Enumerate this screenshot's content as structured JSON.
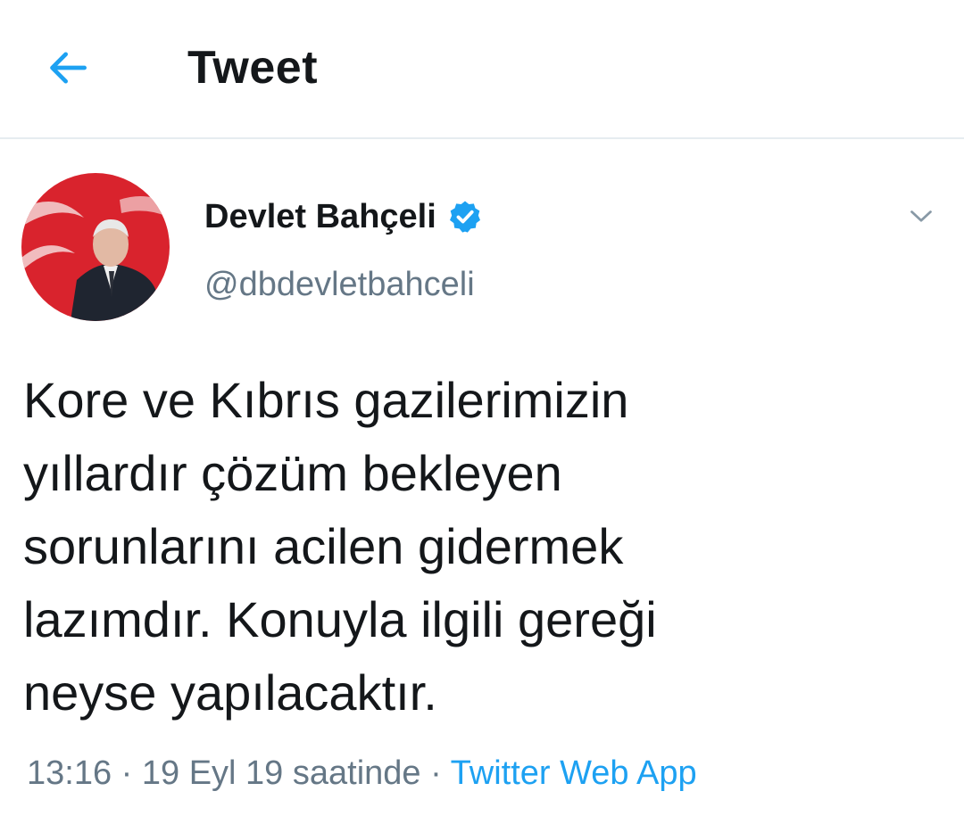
{
  "header": {
    "title": "Tweet",
    "back_icon": "arrow-left-icon"
  },
  "tweet": {
    "author": {
      "display_name": "Devlet Bahçeli",
      "handle": "@dbdevletbahceli",
      "verified": true,
      "verified_icon": "verified-badge-icon"
    },
    "menu_icon": "chevron-down-icon",
    "text_lines": [
      "Kore ve Kıbrıs gazilerimizin",
      "yıllardır çözüm bekleyen",
      "sorunlarını acilen gidermek",
      "lazımdır. Konuyla ilgili gereği",
      "neyse yapılacaktır."
    ],
    "time": "13:16",
    "separator": "·",
    "date": "19 Eyl 19 saatinde",
    "source": "Twitter Web App"
  },
  "colors": {
    "accent": "#1da1f2",
    "text": "#14171a",
    "secondary": "#657786",
    "divider": "#e6ecf0"
  }
}
